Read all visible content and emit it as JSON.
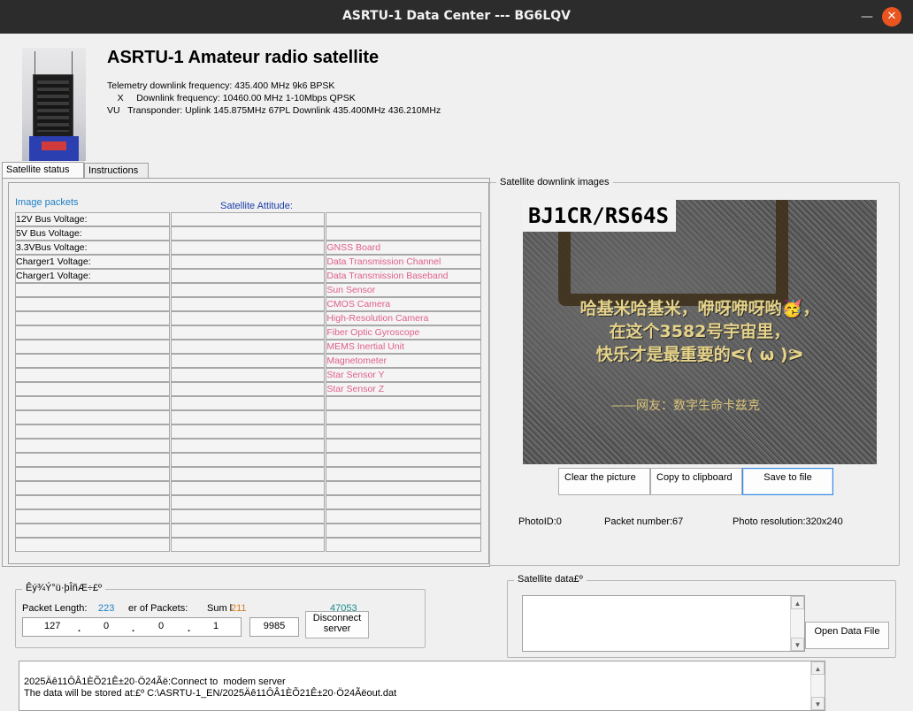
{
  "window": {
    "title": "ASRTU-1 Data Center --- BG6LQV",
    "minimize_glyph": "—",
    "close_glyph": "✕"
  },
  "header": {
    "title": "ASRTU-1  Amateur radio satellite",
    "lines": [
      "Telemetry downlink frequency: 435.400 MHz 9k6 BPSK",
      "    X     Downlink frequency: 10460.00 MHz 1-10Mbps QPSK",
      "VU   Transponder: Uplink 145.875MHz 67PL Downlink 435.400MHz 436.210MHz"
    ]
  },
  "tabs": [
    {
      "label": "Satellite status",
      "active": true
    },
    {
      "label": "Instructions",
      "active": false
    }
  ],
  "status": {
    "image_packets_label": "Image packets",
    "attitude_label": "Satellite Attitude:",
    "rows": [
      [
        "  12V Bus Voltage:",
        "",
        ""
      ],
      [
        "  5V  Bus Voltage:",
        "",
        ""
      ],
      [
        " 3.3VBus Voltage:",
        "",
        "GNSS Board"
      ],
      [
        "Charger1 Voltage:",
        "",
        "Data Transmission Channel"
      ],
      [
        "Charger1 Voltage:",
        "",
        "Data Transmission Baseband"
      ],
      [
        "",
        "",
        "Sun Sensor"
      ],
      [
        "",
        "",
        "CMOS Camera"
      ],
      [
        "",
        "",
        "High-Resolution Camera"
      ],
      [
        "",
        "",
        "Fiber Optic Gyroscope"
      ],
      [
        "",
        "",
        "MEMS Inertial Unit"
      ],
      [
        "",
        "",
        "Magnetometer"
      ],
      [
        "",
        "",
        "Star Sensor Y"
      ],
      [
        "",
        "",
        "Star Sensor Z"
      ],
      [
        "",
        "",
        ""
      ],
      [
        "",
        "",
        ""
      ],
      [
        "",
        "",
        ""
      ],
      [
        "",
        "",
        ""
      ],
      [
        "",
        "",
        ""
      ],
      [
        "",
        "",
        ""
      ],
      [
        "",
        "",
        ""
      ],
      [
        "",
        "",
        ""
      ],
      [
        "",
        "",
        ""
      ],
      [
        "",
        "",
        ""
      ],
      [
        "",
        "",
        ""
      ]
    ]
  },
  "downlink": {
    "group_title": "Satellite downlink images",
    "image": {
      "callsign": "BJ1CR/RS64S",
      "line1": "哈基米哈基米，咿呀咿呀哟🥳，",
      "line2": "在这个3582号宇宙里，",
      "line3": "快乐才是最重要的ᕙ( ω )ᕗ",
      "line4": "——网友：数字生命卡兹克"
    },
    "buttons": {
      "clear": "Clear the picture",
      "copy": "Copy to clipboard",
      "save": "Save to file"
    },
    "photo_id": "PhotoID:0",
    "packet_number": "Packet number:67",
    "photo_resolution": "Photo resolution:320x240"
  },
  "connection": {
    "group_title": "Êý¾Ý°ü·þÎñÆ÷£º",
    "packet_length_label": "Packet Length:",
    "packet_length_value": "223",
    "num_packets_label": "er of Packets:",
    "sum_label": "Sum l",
    "sum_value": "211",
    "count_value": "47053",
    "ip": [
      "127",
      "0",
      "0",
      "1"
    ],
    "port": "9985",
    "disconnect_label": "Disconnect server"
  },
  "satellite_data": {
    "group_title": "Satellite data£º",
    "open_file_label": "Open Data File"
  },
  "log": {
    "lines": [
      "2025Äê11ÔÂ1ÈÕ21Ê±20·Ö24Ãë:Connect to  modem server",
      "The data will be stored at:£º C:\\ASRTU-1_EN/2025Äê11ÔÂ1ÈÕ21Ê±20·Ö24Ãëout.dat"
    ]
  },
  "colors": {
    "titlebar": "#2c2c2c",
    "close_button": "#e95420",
    "blue_label": "#1f7fc4",
    "navy_label": "#1a3fa8",
    "pink_status": "#e0608a",
    "orange_value": "#d97a1a",
    "teal_value": "#1b8c8c"
  }
}
